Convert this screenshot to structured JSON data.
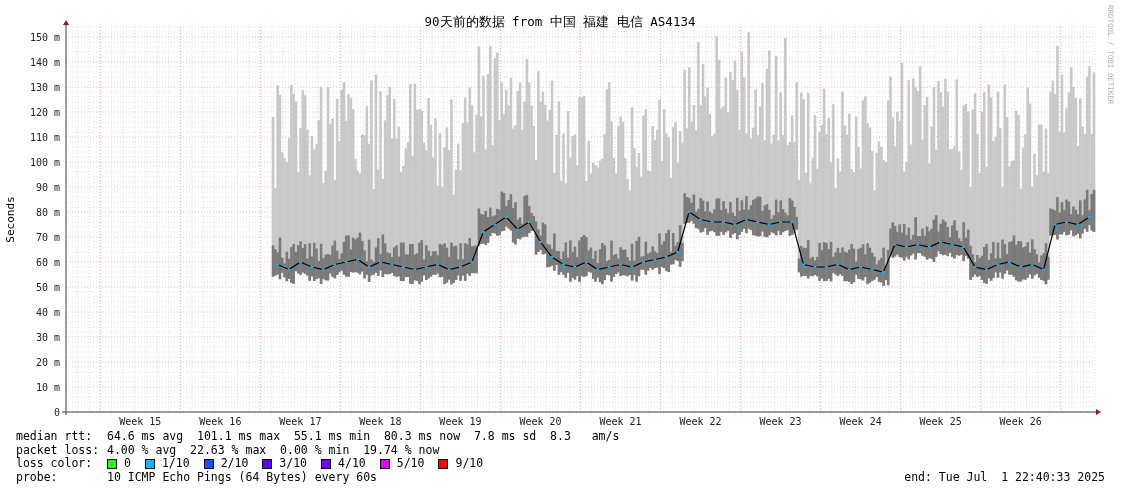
{
  "graph": {
    "title": "90天前的数据 from 中国 福建 电信 AS4134",
    "credit": "RRDTOOL / TOBI OETIKER",
    "chart_data": {
      "type": "line",
      "grid": true,
      "ylabel": "Seconds",
      "ylim": [
        0,
        154
      ],
      "yticks": [
        {
          "value": 0,
          "label": "0"
        },
        {
          "value": 10,
          "label": "10 m"
        },
        {
          "value": 20,
          "label": "20 m"
        },
        {
          "value": 30,
          "label": "30 m"
        },
        {
          "value": 40,
          "label": "40 m"
        },
        {
          "value": 50,
          "label": "50 m"
        },
        {
          "value": 60,
          "label": "60 m"
        },
        {
          "value": 70,
          "label": "70 m"
        },
        {
          "value": 80,
          "label": "80 m"
        },
        {
          "value": 90,
          "label": "90 m"
        },
        {
          "value": 100,
          "label": "100 m"
        },
        {
          "value": 110,
          "label": "110 m"
        },
        {
          "value": 120,
          "label": "120 m"
        },
        {
          "value": 130,
          "label": "130 m"
        },
        {
          "value": 140,
          "label": "140 m"
        },
        {
          "value": 150,
          "label": "150 m"
        }
      ],
      "categories": [
        null,
        null,
        null,
        null,
        null,
        null,
        "Week 15",
        null,
        null,
        null,
        null,
        null,
        null,
        "Week 16",
        null,
        null,
        null,
        null,
        null,
        null,
        "Week 17",
        null,
        null,
        null,
        null,
        null,
        null,
        "Week 18",
        null,
        null,
        null,
        null,
        null,
        null,
        "Week 19",
        null,
        null,
        null,
        null,
        null,
        null,
        "Week 20",
        null,
        null,
        null,
        null,
        null,
        null,
        "Week 21",
        null,
        null,
        null,
        null,
        null,
        null,
        "Week 22",
        null,
        null,
        null,
        null,
        null,
        null,
        "Week 23",
        null,
        null,
        null,
        null,
        null,
        null,
        "Week 24",
        null,
        null,
        null,
        null,
        null,
        null,
        "Week 25",
        null,
        null,
        null,
        null,
        null,
        null,
        "Week 26",
        null,
        null,
        null,
        null,
        null,
        null
      ],
      "series": [
        {
          "color": "#000000",
          "marker": true,
          "values": [
            null,
            null,
            null,
            null,
            null,
            null,
            null,
            null,
            null,
            null,
            null,
            null,
            null,
            null,
            null,
            null,
            null,
            null,
            59,
            57,
            60,
            58,
            57,
            59,
            60,
            61,
            58,
            60,
            59,
            58,
            57,
            58,
            59,
            57,
            58,
            60,
            72,
            75,
            78,
            73,
            76,
            68,
            62,
            59,
            58,
            60,
            57,
            58,
            59,
            58,
            60,
            61,
            62,
            64,
            80,
            77,
            76,
            76,
            75,
            77,
            76,
            75,
            76,
            76,
            59,
            58,
            58,
            59,
            57,
            58,
            57,
            56,
            67,
            66,
            67,
            66,
            68,
            67,
            66,
            58,
            57,
            59,
            60,
            58,
            59,
            57,
            75,
            76,
            75,
            78
          ]
        }
      ]
    }
  },
  "stats": [
    {
      "label": "median rtt:",
      "text": "64.6 ms avg  101.1 ms max  55.1 ms min  80.3 ms now  7.8 ms sd  8.3   am/s"
    },
    {
      "label": "packet loss:",
      "text": "4.00 % avg  22.63 % max  0.00 % min  19.74 % now"
    }
  ],
  "loss_legend": {
    "label": "loss color:",
    "items": [
      {
        "label": "0",
        "color": "#26ff00"
      },
      {
        "label": "1/10",
        "color": "#00b8ff"
      },
      {
        "label": "2/10",
        "color": "#0059ff"
      },
      {
        "label": "3/10",
        "color": "#5e00ff"
      },
      {
        "label": "4/10",
        "color": "#7e00ff"
      },
      {
        "label": "5/10",
        "color": "#dd00ff"
      },
      {
        "label": "9/10",
        "color": "#ff0000"
      }
    ]
  },
  "probe": {
    "label": "probe:",
    "text": "10 ICMP Echo Pings (64 Bytes) every 60s"
  },
  "end": "end: Tue Jul  1 22:40:33 2025"
}
